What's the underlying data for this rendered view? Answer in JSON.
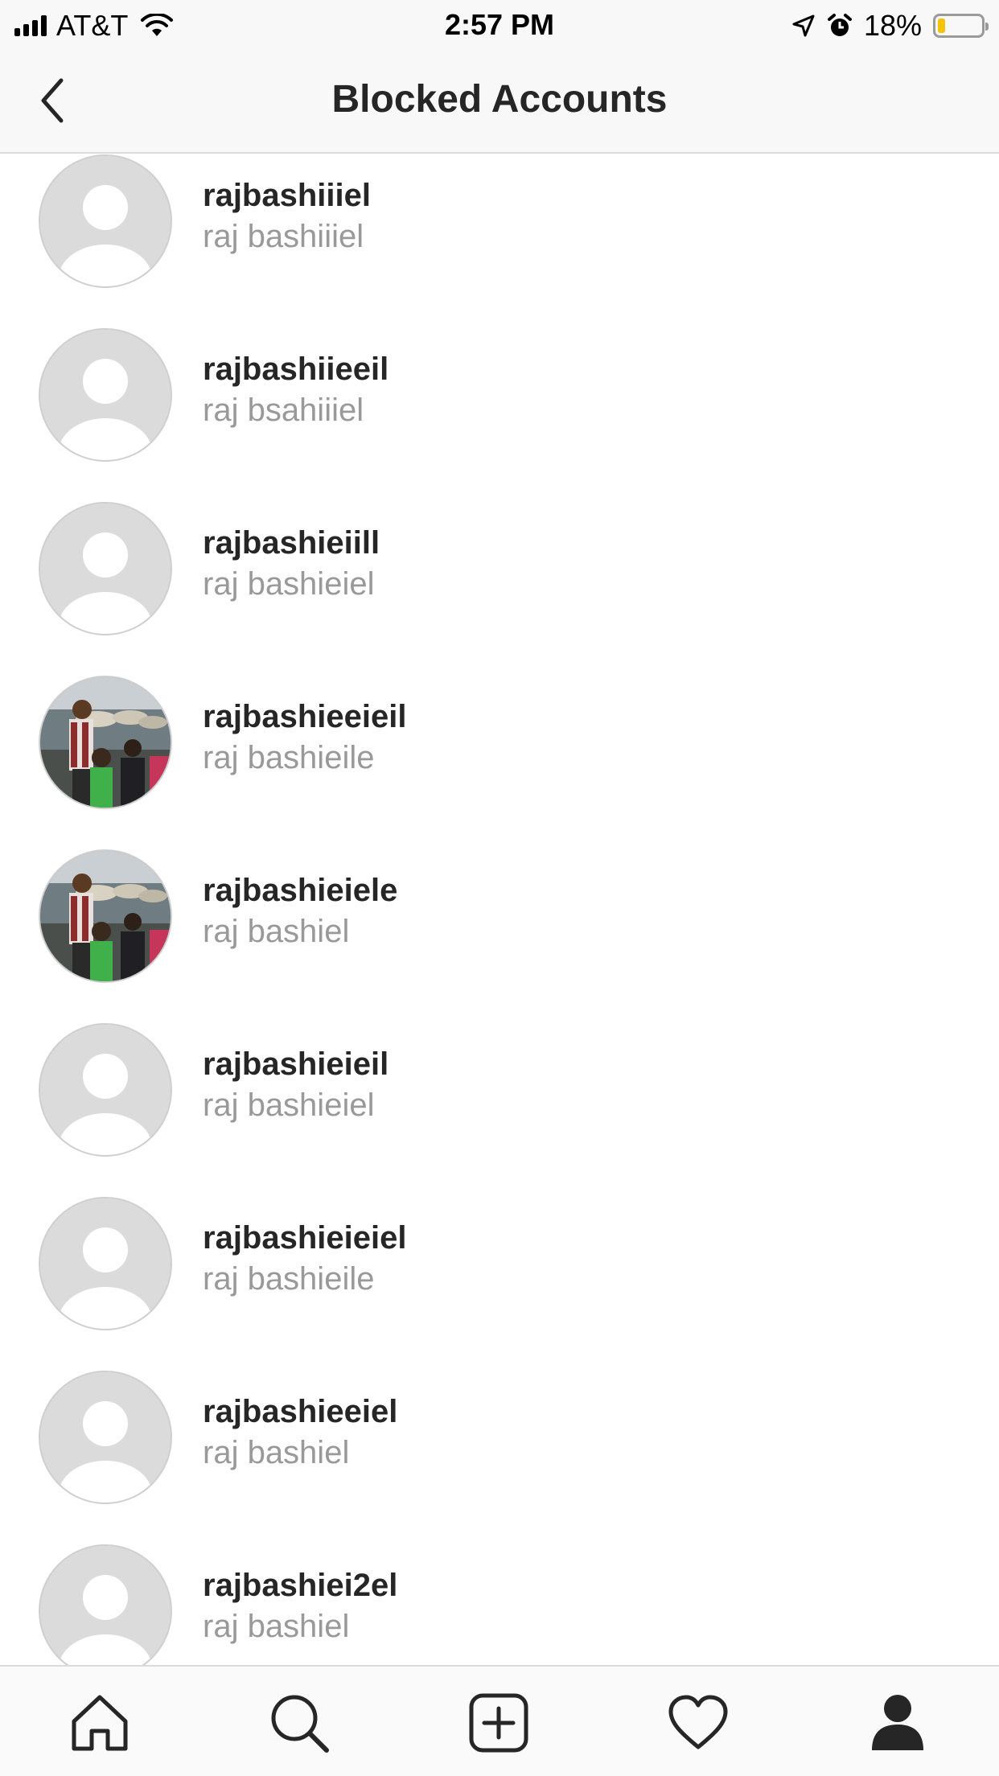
{
  "status_bar": {
    "carrier": "AT&T",
    "time": "2:57 PM",
    "battery_percent": "18%",
    "battery_level": 0.18,
    "battery_color": "#f5c400"
  },
  "nav": {
    "title": "Blocked Accounts",
    "back_icon": "chevron-left-icon"
  },
  "accounts": [
    {
      "username": "rajbashiiiel",
      "full_name": "raj bashiiiel",
      "avatar": "default-avatar"
    },
    {
      "username": "rajbashiieeil",
      "full_name": "raj bsahiiiel",
      "avatar": "default-avatar"
    },
    {
      "username": "rajbashieiill",
      "full_name": "raj bashieiel",
      "avatar": "default-avatar"
    },
    {
      "username": "rajbashieeieil",
      "full_name": "raj bashieile",
      "avatar": "photo"
    },
    {
      "username": "rajbashieiele",
      "full_name": "raj bashiel",
      "avatar": "photo"
    },
    {
      "username": "rajbashieieil",
      "full_name": "raj bashieiel",
      "avatar": "default-avatar"
    },
    {
      "username": "rajbashieieiel",
      "full_name": "raj bashieile",
      "avatar": "default-avatar"
    },
    {
      "username": "rajbashieeiel",
      "full_name": "raj bashiel",
      "avatar": "default-avatar"
    },
    {
      "username": "rajbashiei2el",
      "full_name": "raj bashiel",
      "avatar": "default-avatar"
    }
  ],
  "tab_bar": {
    "items": [
      "home-icon",
      "search-icon",
      "add-post-icon",
      "heart-icon",
      "profile-icon"
    ],
    "active": "profile-icon"
  },
  "colors": {
    "text_primary": "#262626",
    "text_secondary": "#999999",
    "divider": "#dbdbdb",
    "avatar_placeholder": "#dbdbdb"
  }
}
